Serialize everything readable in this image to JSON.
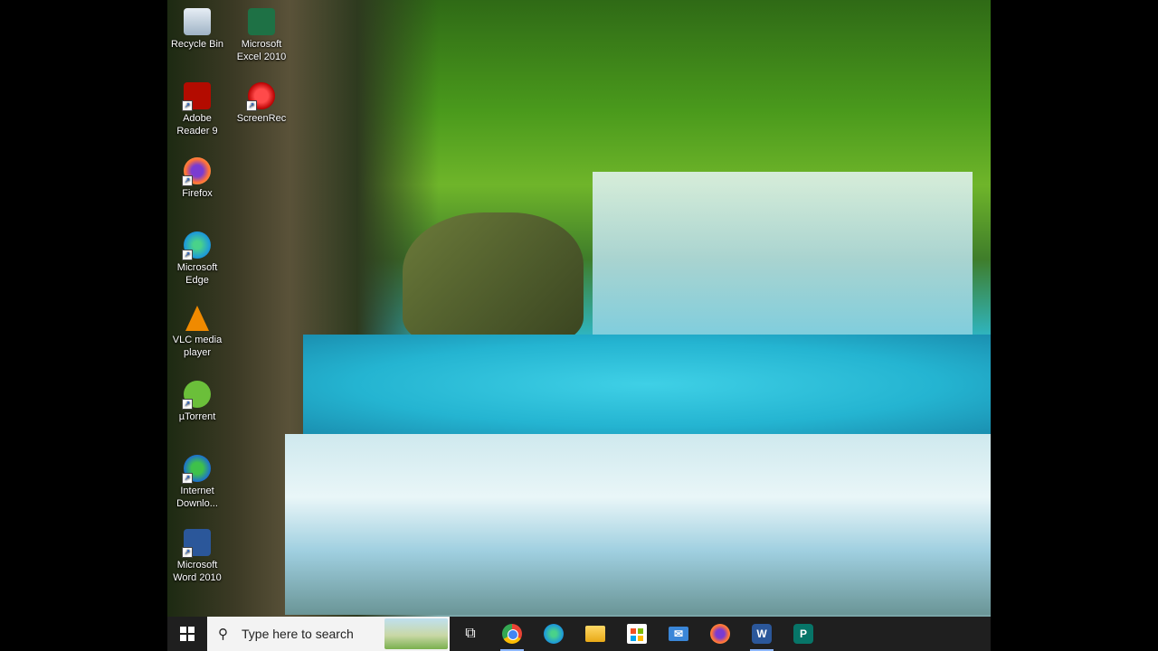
{
  "desktop": {
    "icons": [
      {
        "label": "Recycle Bin",
        "icon": "recycle-bin-icon",
        "shortcut": false
      },
      {
        "label": "Microsoft Excel 2010",
        "icon": "excel-icon",
        "shortcut": false
      },
      {
        "label": "Adobe Reader 9",
        "icon": "adobe-reader-icon",
        "shortcut": true
      },
      {
        "label": "ScreenRec",
        "icon": "screenrec-icon",
        "shortcut": true
      },
      {
        "label": "Firefox",
        "icon": "firefox-icon",
        "shortcut": true
      },
      {
        "label": "Microsoft Edge",
        "icon": "edge-icon",
        "shortcut": true
      },
      {
        "label": "VLC media player",
        "icon": "vlc-icon",
        "shortcut": true
      },
      {
        "label": "µTorrent",
        "icon": "utorrent-icon",
        "shortcut": true
      },
      {
        "label": "Internet Downlo...",
        "icon": "internet-download-manager-icon",
        "shortcut": true
      },
      {
        "label": "Microsoft Word 2010",
        "icon": "word-icon",
        "shortcut": true
      }
    ]
  },
  "taskbar": {
    "search_placeholder": "Type here to search",
    "apps": [
      {
        "name": "task-view",
        "icon": "task-view-icon",
        "glyph": "⧉",
        "color": "#1f1f1f"
      },
      {
        "name": "chrome",
        "icon": "chrome-icon",
        "glyph": "",
        "color": "#e94235",
        "active": true
      },
      {
        "name": "edge",
        "icon": "edge-icon",
        "glyph": "",
        "color": "#1e9bd7"
      },
      {
        "name": "file-explorer",
        "icon": "folder-icon",
        "glyph": "",
        "color": "#f4c542"
      },
      {
        "name": "microsoft-store",
        "icon": "store-icon",
        "glyph": "",
        "color": "#2b7cd3"
      },
      {
        "name": "mail",
        "icon": "mail-icon",
        "glyph": "✉",
        "color": "#3a86d8"
      },
      {
        "name": "firefox",
        "icon": "firefox-icon",
        "glyph": "",
        "color": "#ff7139"
      },
      {
        "name": "word",
        "icon": "word-icon",
        "glyph": "W",
        "color": "#2b579a",
        "active": true
      },
      {
        "name": "publisher",
        "icon": "publisher-icon",
        "glyph": "P",
        "color": "#077568"
      }
    ]
  }
}
